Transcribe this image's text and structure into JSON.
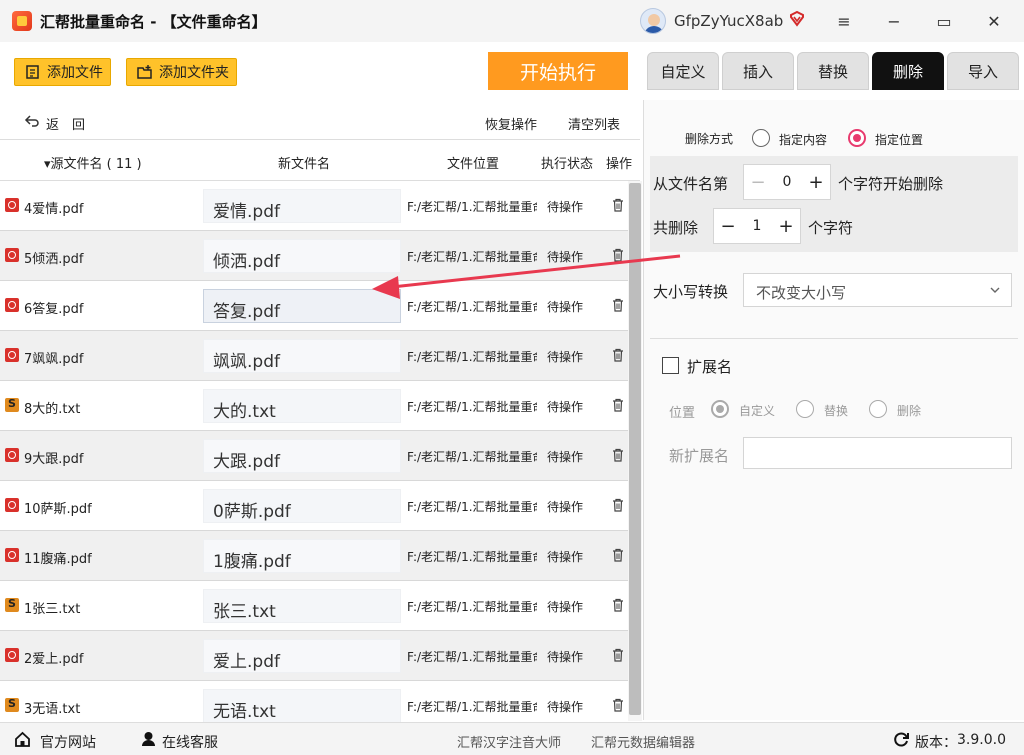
{
  "window": {
    "title": "汇帮批量重命名 - 【文件重命名】",
    "user_name": "GfpZyYucX8ab",
    "minimize": "−",
    "menu": "≡",
    "maximize": "▭",
    "close": "✕"
  },
  "toolbar": {
    "add_file": "添加文件",
    "add_folder": "添加文件夹",
    "start": "开始执行"
  },
  "tabs": [
    {
      "label": "自定义",
      "active": false
    },
    {
      "label": "插入",
      "active": false
    },
    {
      "label": "替换",
      "active": false
    },
    {
      "label": "删除",
      "active": true
    },
    {
      "label": "导入",
      "active": false
    }
  ],
  "list_actions": {
    "back": "返　回",
    "restore": "恢复操作",
    "clear": "清空列表"
  },
  "columns": {
    "source": "▾源文件名 ( 11 )",
    "new_name": "新文件名",
    "location": "文件位置",
    "status": "执行状态",
    "action": "操作"
  },
  "rows": [
    {
      "src": "4爱情.pdf",
      "new": "爱情.pdf",
      "type": "pdf",
      "loc": "F:/老汇帮/1.汇帮批量重命",
      "status": "待操作"
    },
    {
      "src": "5倾洒.pdf",
      "new": "倾洒.pdf",
      "type": "pdf",
      "loc": "F:/老汇帮/1.汇帮批量重命",
      "status": "待操作"
    },
    {
      "src": "6答复.pdf",
      "new": "答复.pdf",
      "type": "pdf",
      "loc": "F:/老汇帮/1.汇帮批量重命",
      "status": "待操作"
    },
    {
      "src": "7飒飒.pdf",
      "new": "飒飒.pdf",
      "type": "pdf",
      "loc": "F:/老汇帮/1.汇帮批量重命",
      "status": "待操作"
    },
    {
      "src": "8大的.txt",
      "new": "大的.txt",
      "type": "txt",
      "loc": "F:/老汇帮/1.汇帮批量重命",
      "status": "待操作"
    },
    {
      "src": "9大跟.pdf",
      "new": "大跟.pdf",
      "type": "pdf",
      "loc": "F:/老汇帮/1.汇帮批量重命",
      "status": "待操作"
    },
    {
      "src": "10萨斯.pdf",
      "new": "0萨斯.pdf",
      "type": "pdf",
      "loc": "F:/老汇帮/1.汇帮批量重命",
      "status": "待操作"
    },
    {
      "src": "11腹痛.pdf",
      "new": "1腹痛.pdf",
      "type": "pdf",
      "loc": "F:/老汇帮/1.汇帮批量重命",
      "status": "待操作"
    },
    {
      "src": "1张三.txt",
      "new": "张三.txt",
      "type": "txt",
      "loc": "F:/老汇帮/1.汇帮批量重命",
      "status": "待操作"
    },
    {
      "src": "2爱上.pdf",
      "new": "爱上.pdf",
      "type": "pdf",
      "loc": "F:/老汇帮/1.汇帮批量重命",
      "status": "待操作"
    },
    {
      "src": "3无语.txt",
      "new": "无语.txt",
      "type": "txt",
      "loc": "F:/老汇帮/1.汇帮批量重命",
      "status": "待操作"
    }
  ],
  "panel": {
    "delete_mode_label": "删除方式",
    "mode_content": "指定内容",
    "mode_position": "指定位置",
    "selected_mode": "指定位置",
    "from_label": "从文件名第",
    "from_value": "0",
    "from_suffix": "个字符开始删除",
    "count_label": "共删除",
    "count_value": "1",
    "count_suffix": "个字符",
    "case_label": "大小写转换",
    "case_value": "不改变大小写",
    "ext_label": "扩展名",
    "ext_checked": false,
    "position_label": "位置",
    "pos_custom": "自定义",
    "pos_replace": "替换",
    "pos_delete": "删除",
    "new_ext_label": "新扩展名",
    "new_ext_value": ""
  },
  "footer": {
    "website": "官方网站",
    "support": "在线客服",
    "pinyin": "汇帮汉字注音大师",
    "metadata": "汇帮元数据编辑器",
    "version_label": "版本：",
    "version": "3.9.0.0"
  },
  "colors": {
    "accent_yellow": "#ffc22a",
    "start_orange": "#ff9a1f",
    "active_tab": "#111111",
    "radio_on": "#e83a6e",
    "arrow_red": "#e8394f"
  }
}
